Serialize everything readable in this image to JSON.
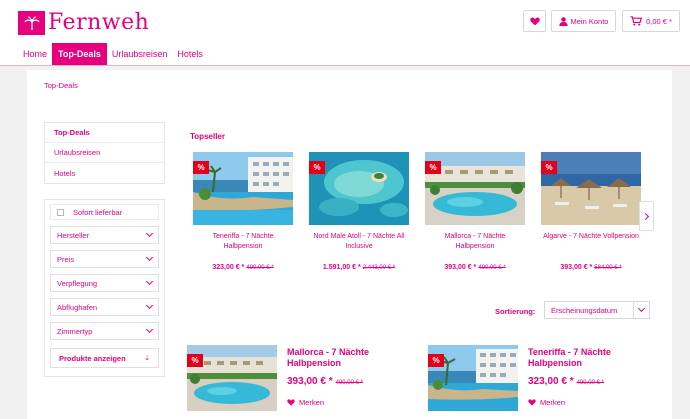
{
  "brand": {
    "name": "Fernweh"
  },
  "header": {
    "account_label": "Mein Konto",
    "cart_total": "0,00 € *"
  },
  "nav": {
    "items": [
      {
        "label": "Home"
      },
      {
        "label": "Top-Deals",
        "active": true
      },
      {
        "label": "Urlaubsreisen"
      },
      {
        "label": "Hotels"
      }
    ]
  },
  "breadcrumb": "Top-Deals",
  "sidebar": {
    "categories": [
      {
        "label": "Top-Deals",
        "active": true
      },
      {
        "label": "Urlaubsreisen"
      },
      {
        "label": "Hotels"
      }
    ],
    "filters": {
      "checkbox_label": "Sofort lieferbar",
      "items": [
        "Hersteller",
        "Preis",
        "Verpflegung",
        "Abflughafen",
        "Zimmertyp"
      ],
      "show_button": "Produkte anzeigen"
    }
  },
  "topseller": {
    "title": "Topseller",
    "badge": "%",
    "products": [
      {
        "name": "Teneriffa - 7 Nächte Halbpension",
        "price": "323,00 € *",
        "old_price": "490,00 € *"
      },
      {
        "name": "Nord Male Atoll - 7 Nächte All Inclusive",
        "price": "1.591,00 € *",
        "old_price": "2.443,00 € *"
      },
      {
        "name": "Mallorca - 7 Nächte Halbpension",
        "price": "393,00 € *",
        "old_price": "490,00 € *"
      },
      {
        "name": "Algarve - 7 Nächte Vollpension",
        "price": "393,00 € *",
        "old_price": "584,00 € *"
      }
    ]
  },
  "sorting": {
    "label": "Sortierung:",
    "selected": "Erscheinungsdatum"
  },
  "listing": {
    "badge": "%",
    "merken_label": "Merken",
    "products": [
      {
        "name": "Mallorca - 7 Nächte Halbpension",
        "price": "393,00 € *",
        "old_price": "490,00 € *"
      },
      {
        "name": "Teneriffa - 7 Nächte Halbpension",
        "price": "323,00 € *",
        "old_price": "490,00 € *"
      }
    ]
  },
  "colors": {
    "accent": "#e6007e",
    "badge": "#e3001b"
  },
  "icons": [
    "palm-logo-icon",
    "heart-icon",
    "user-icon",
    "cart-icon",
    "chevron-down-icon",
    "chevron-right-icon",
    "list-icon"
  ]
}
